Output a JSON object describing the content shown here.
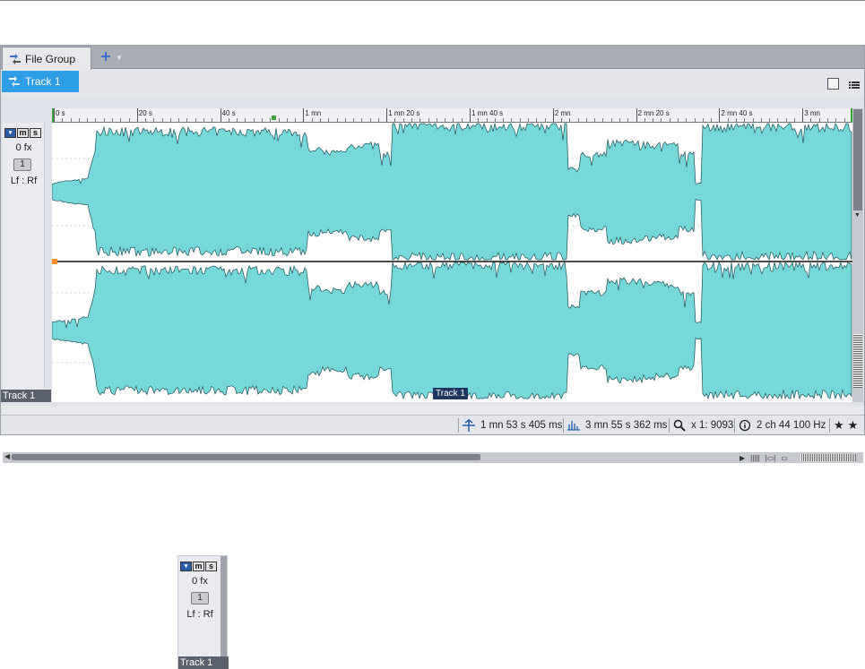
{
  "file_group_tab": "File Group",
  "track_tab": "Track 1",
  "track_header": {
    "buttons": [
      "▾",
      "m",
      "s"
    ],
    "fx": "0 fx",
    "number": "1",
    "routing": "Lf : Rf",
    "name": "Track 1"
  },
  "ruler": {
    "labels": [
      "0 s",
      "20 s",
      "40 s",
      "1 mn",
      "1 mn 20 s",
      "1 mn 40 s",
      "2 mn",
      "2 mn 20 s",
      "2 mn 40 s",
      "3 mn"
    ]
  },
  "waveform": {
    "track_name_label": "Track 1",
    "color": "#76d8d8",
    "outline_color": "#1c4f58",
    "channels": 2
  },
  "status_bar": {
    "cursor_position": "1 mn 53 s 405 ms",
    "file_length": "3 mn 55 s 362 ms",
    "zoom": "x 1: 9093",
    "audio_properties": "2 ch 44 100 Hz"
  },
  "icons": {
    "add": "plus-icon",
    "cursor_pos": "cursor-position-icon",
    "length": "waveform-length-icon",
    "zoom": "magnifier-icon",
    "info": "info-icon",
    "star": "star-icon"
  }
}
